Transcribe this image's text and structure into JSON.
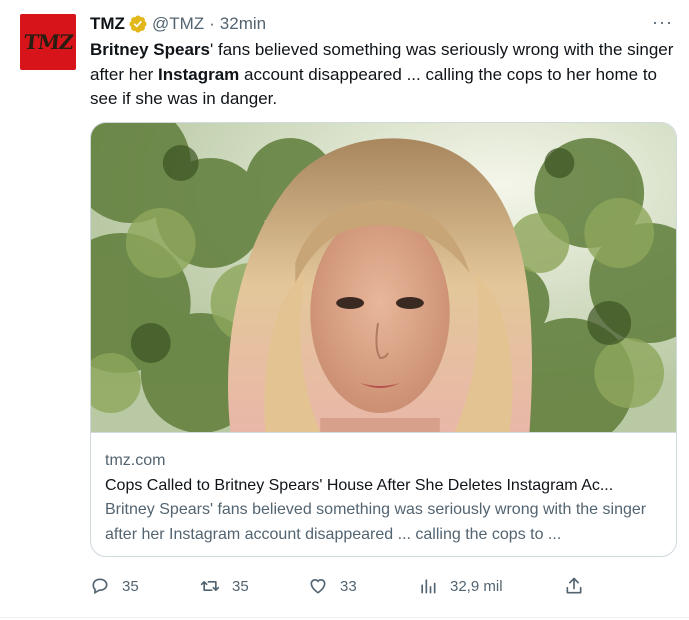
{
  "tweet": {
    "avatar_text": "TMZ",
    "name": "TMZ",
    "handle": "@TMZ",
    "separator": "·",
    "time": "32min",
    "more": "···",
    "text": {
      "p1": "Britney Spears",
      "p2": "' fans believed something was seriously wrong with the singer after her ",
      "p3": "Instagram",
      "p4": " account disappeared ... calling the cops to her home to see if she was in danger."
    }
  },
  "card": {
    "domain": "tmz.com",
    "title": "Cops Called to Britney Spears' House After She Deletes Instagram Ac...",
    "description": "Britney Spears' fans believed something was seriously wrong with the singer after her Instagram account disappeared ... calling the cops to ..."
  },
  "actions": {
    "replies": "35",
    "retweets": "35",
    "likes": "33",
    "views": "32,9 mil"
  },
  "colors": {
    "text": "#0f1419",
    "secondary": "#536471",
    "brand_red": "#d8141b",
    "verified_gold": "#e2b719",
    "border": "#cfd9de"
  },
  "icons": [
    "verified-badge-icon",
    "more-icon",
    "reply-icon",
    "retweet-icon",
    "like-icon",
    "views-icon",
    "share-icon"
  ]
}
